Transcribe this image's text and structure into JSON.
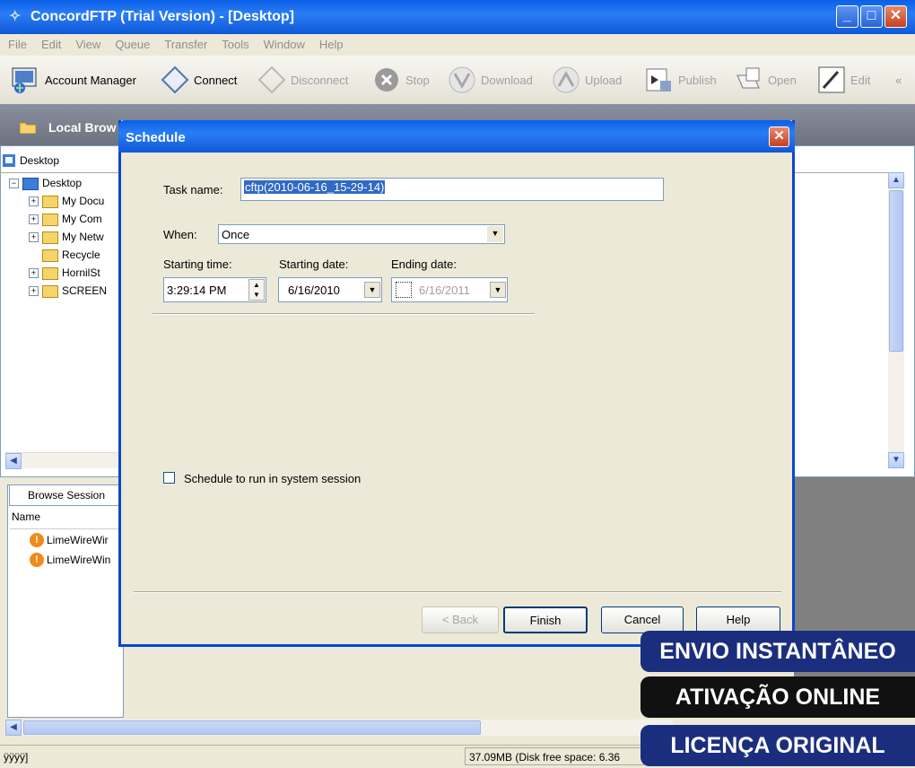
{
  "window": {
    "title": "ConcordFTP (Trial Version) - [Desktop]"
  },
  "menu": [
    "File",
    "Edit",
    "View",
    "Queue",
    "Transfer",
    "Tools",
    "Window",
    "Help"
  ],
  "toolbar": {
    "account_manager": "Account Manager",
    "connect": "Connect",
    "disconnect": "Disconnect",
    "stop": "Stop",
    "download": "Download",
    "upload": "Upload",
    "publish": "Publish",
    "open": "Open",
    "edit": "Edit"
  },
  "local_panel": {
    "title": "Local Brow",
    "address": "Desktop"
  },
  "tree": [
    {
      "label": "Desktop",
      "indent": 0,
      "expander": "−"
    },
    {
      "label": "My Docu",
      "indent": 1,
      "expander": "+"
    },
    {
      "label": "My Com",
      "indent": 1,
      "expander": "+"
    },
    {
      "label": "My Netw",
      "indent": 1,
      "expander": "+"
    },
    {
      "label": "Recycle",
      "indent": 1,
      "expander": ""
    },
    {
      "label": "HornilSt",
      "indent": 1,
      "expander": "+"
    },
    {
      "label": "SCREEN",
      "indent": 1,
      "expander": "+"
    }
  ],
  "sessions": {
    "tab": "Browse Session",
    "column": "Name",
    "items": [
      "LimeWireWir",
      "LimeWireWin"
    ]
  },
  "status": {
    "left": "ÿÿÿÿ]",
    "right": "37.09MB (Disk free space: 6.36"
  },
  "dialog": {
    "title": "Schedule",
    "task_name_label": "Task name:",
    "task_name_value": "cftp(2010-06-16_15-29-14)",
    "when_label": "When:",
    "when_value": "Once",
    "start_time_label": "Starting time:",
    "start_time_value": "3:29:14 PM",
    "start_date_label": "Starting date:",
    "start_date_value": "6/16/2010",
    "end_date_label": "Ending date:",
    "end_date_value": "6/16/2011",
    "system_session_label": "Schedule to run in system session",
    "buttons": {
      "back": "< Back",
      "finish": "Finish",
      "cancel": "Cancel",
      "help": "Help"
    }
  },
  "banners": [
    "ENVIO INSTANTÂNEO",
    "ATIVAÇÃO ONLINE",
    "LICENÇA ORIGINAL"
  ]
}
